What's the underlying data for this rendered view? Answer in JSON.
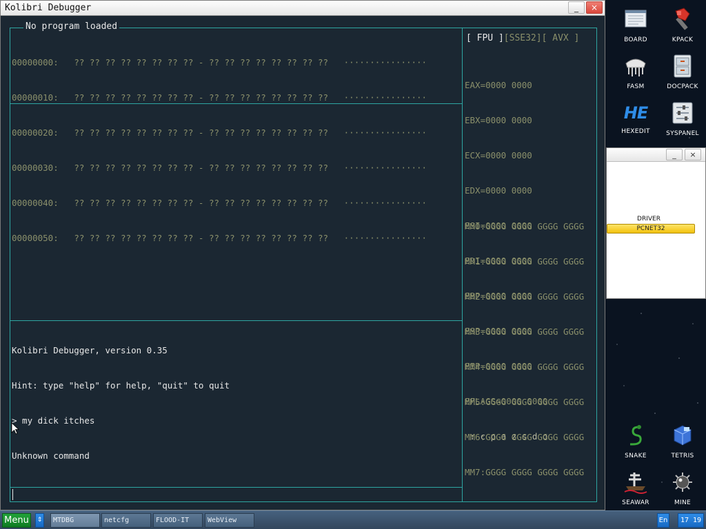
{
  "window": {
    "title": "Kolibri Debugger",
    "min_glyph": "_",
    "close_glyph": "×",
    "status_label": "No program loaded"
  },
  "dump": {
    "rows": [
      {
        "addr": "00000000:",
        "bytes": "?? ?? ?? ?? ?? ?? ?? ?? - ?? ?? ?? ?? ?? ?? ?? ??",
        "ascii": "················"
      },
      {
        "addr": "00000010:",
        "bytes": "?? ?? ?? ?? ?? ?? ?? ?? - ?? ?? ?? ?? ?? ?? ?? ??",
        "ascii": "················"
      },
      {
        "addr": "00000020:",
        "bytes": "?? ?? ?? ?? ?? ?? ?? ?? - ?? ?? ?? ?? ?? ?? ?? ??",
        "ascii": "················"
      },
      {
        "addr": "00000030:",
        "bytes": "?? ?? ?? ?? ?? ?? ?? ?? - ?? ?? ?? ?? ?? ?? ?? ??",
        "ascii": "················"
      },
      {
        "addr": "00000040:",
        "bytes": "?? ?? ?? ?? ?? ?? ?? ?? - ?? ?? ?? ?? ?? ?? ?? ??",
        "ascii": "················"
      },
      {
        "addr": "00000050:",
        "bytes": "?? ?? ?? ?? ?? ?? ?? ?? - ?? ?? ?? ?? ?? ?? ?? ??",
        "ascii": "················"
      }
    ]
  },
  "register_tabs": {
    "fpu": "[ FPU ]",
    "sse32": "[SSE32]",
    "avx": "[ AVX ]"
  },
  "registers": [
    "EAX=0000 0000",
    "EBX=0000 0000",
    "ECX=0000 0000",
    "EDX=0000 0000",
    "ESI=0000 0000",
    "EDI=0000 0000",
    "EBP=0000 0000",
    "ESP=0000 0000",
    "EIP=0000 0000",
    "EFLAGS=0000 0000"
  ],
  "flags_line": " : c p a z s d o",
  "mmx_registers": [
    "MM0:GGGG GGGG GGGG GGGG",
    "MM1:GGGG GGGG GGGG GGGG",
    "MM2:GGGG GGGG GGGG GGGG",
    "MM3:GGGG GGGG GGGG GGGG",
    "MM4:GGGG GGGG GGGG GGGG",
    "MM5:GGGG GGGG GGGG GGGG",
    "MM6:GGGG GGGG GGGG GGGG",
    "MM7:GGGG GGGG GGGG GGGG"
  ],
  "console": {
    "lines": [
      "Kolibri Debugger, version 0.35",
      "Hint: type \"help\" for help, \"quit\" to quit",
      "> my dick itches",
      "Unknown command"
    ],
    "input_value": ""
  },
  "desktop_icons": {
    "board": "BOARD",
    "kpack": "KPACK",
    "fasm": "FASM",
    "docpack": "DOCPACK",
    "hexedit": "HEXEDIT",
    "hexedit_glyph": "HE",
    "syspanel": "SYSPANEL",
    "snake": "SNAKE",
    "tetris": "TETRIS",
    "seawar": "SEAWAR",
    "mine": "MINE"
  },
  "driver_panel": {
    "label": "DRIVER",
    "name": "PCNET32",
    "min_glyph": "_",
    "close_glyph": "×"
  },
  "taskbar": {
    "menu_label": "Menu",
    "switch_glyph": "⇕",
    "tasks": [
      "MTDBG",
      "netcfg",
      "FLOOD-IT",
      "WebView"
    ],
    "lang": "En",
    "clock": "17 19"
  },
  "colors": {
    "window_bg": "#1b2732",
    "panel_border": "#2ea6a2",
    "dim_text": "#8a8f6a",
    "console_text": "#e6e6e6",
    "menu_green": "#1b9a33",
    "tray_blue": "#2279d6",
    "driver_chip": "#f5cc1c"
  }
}
